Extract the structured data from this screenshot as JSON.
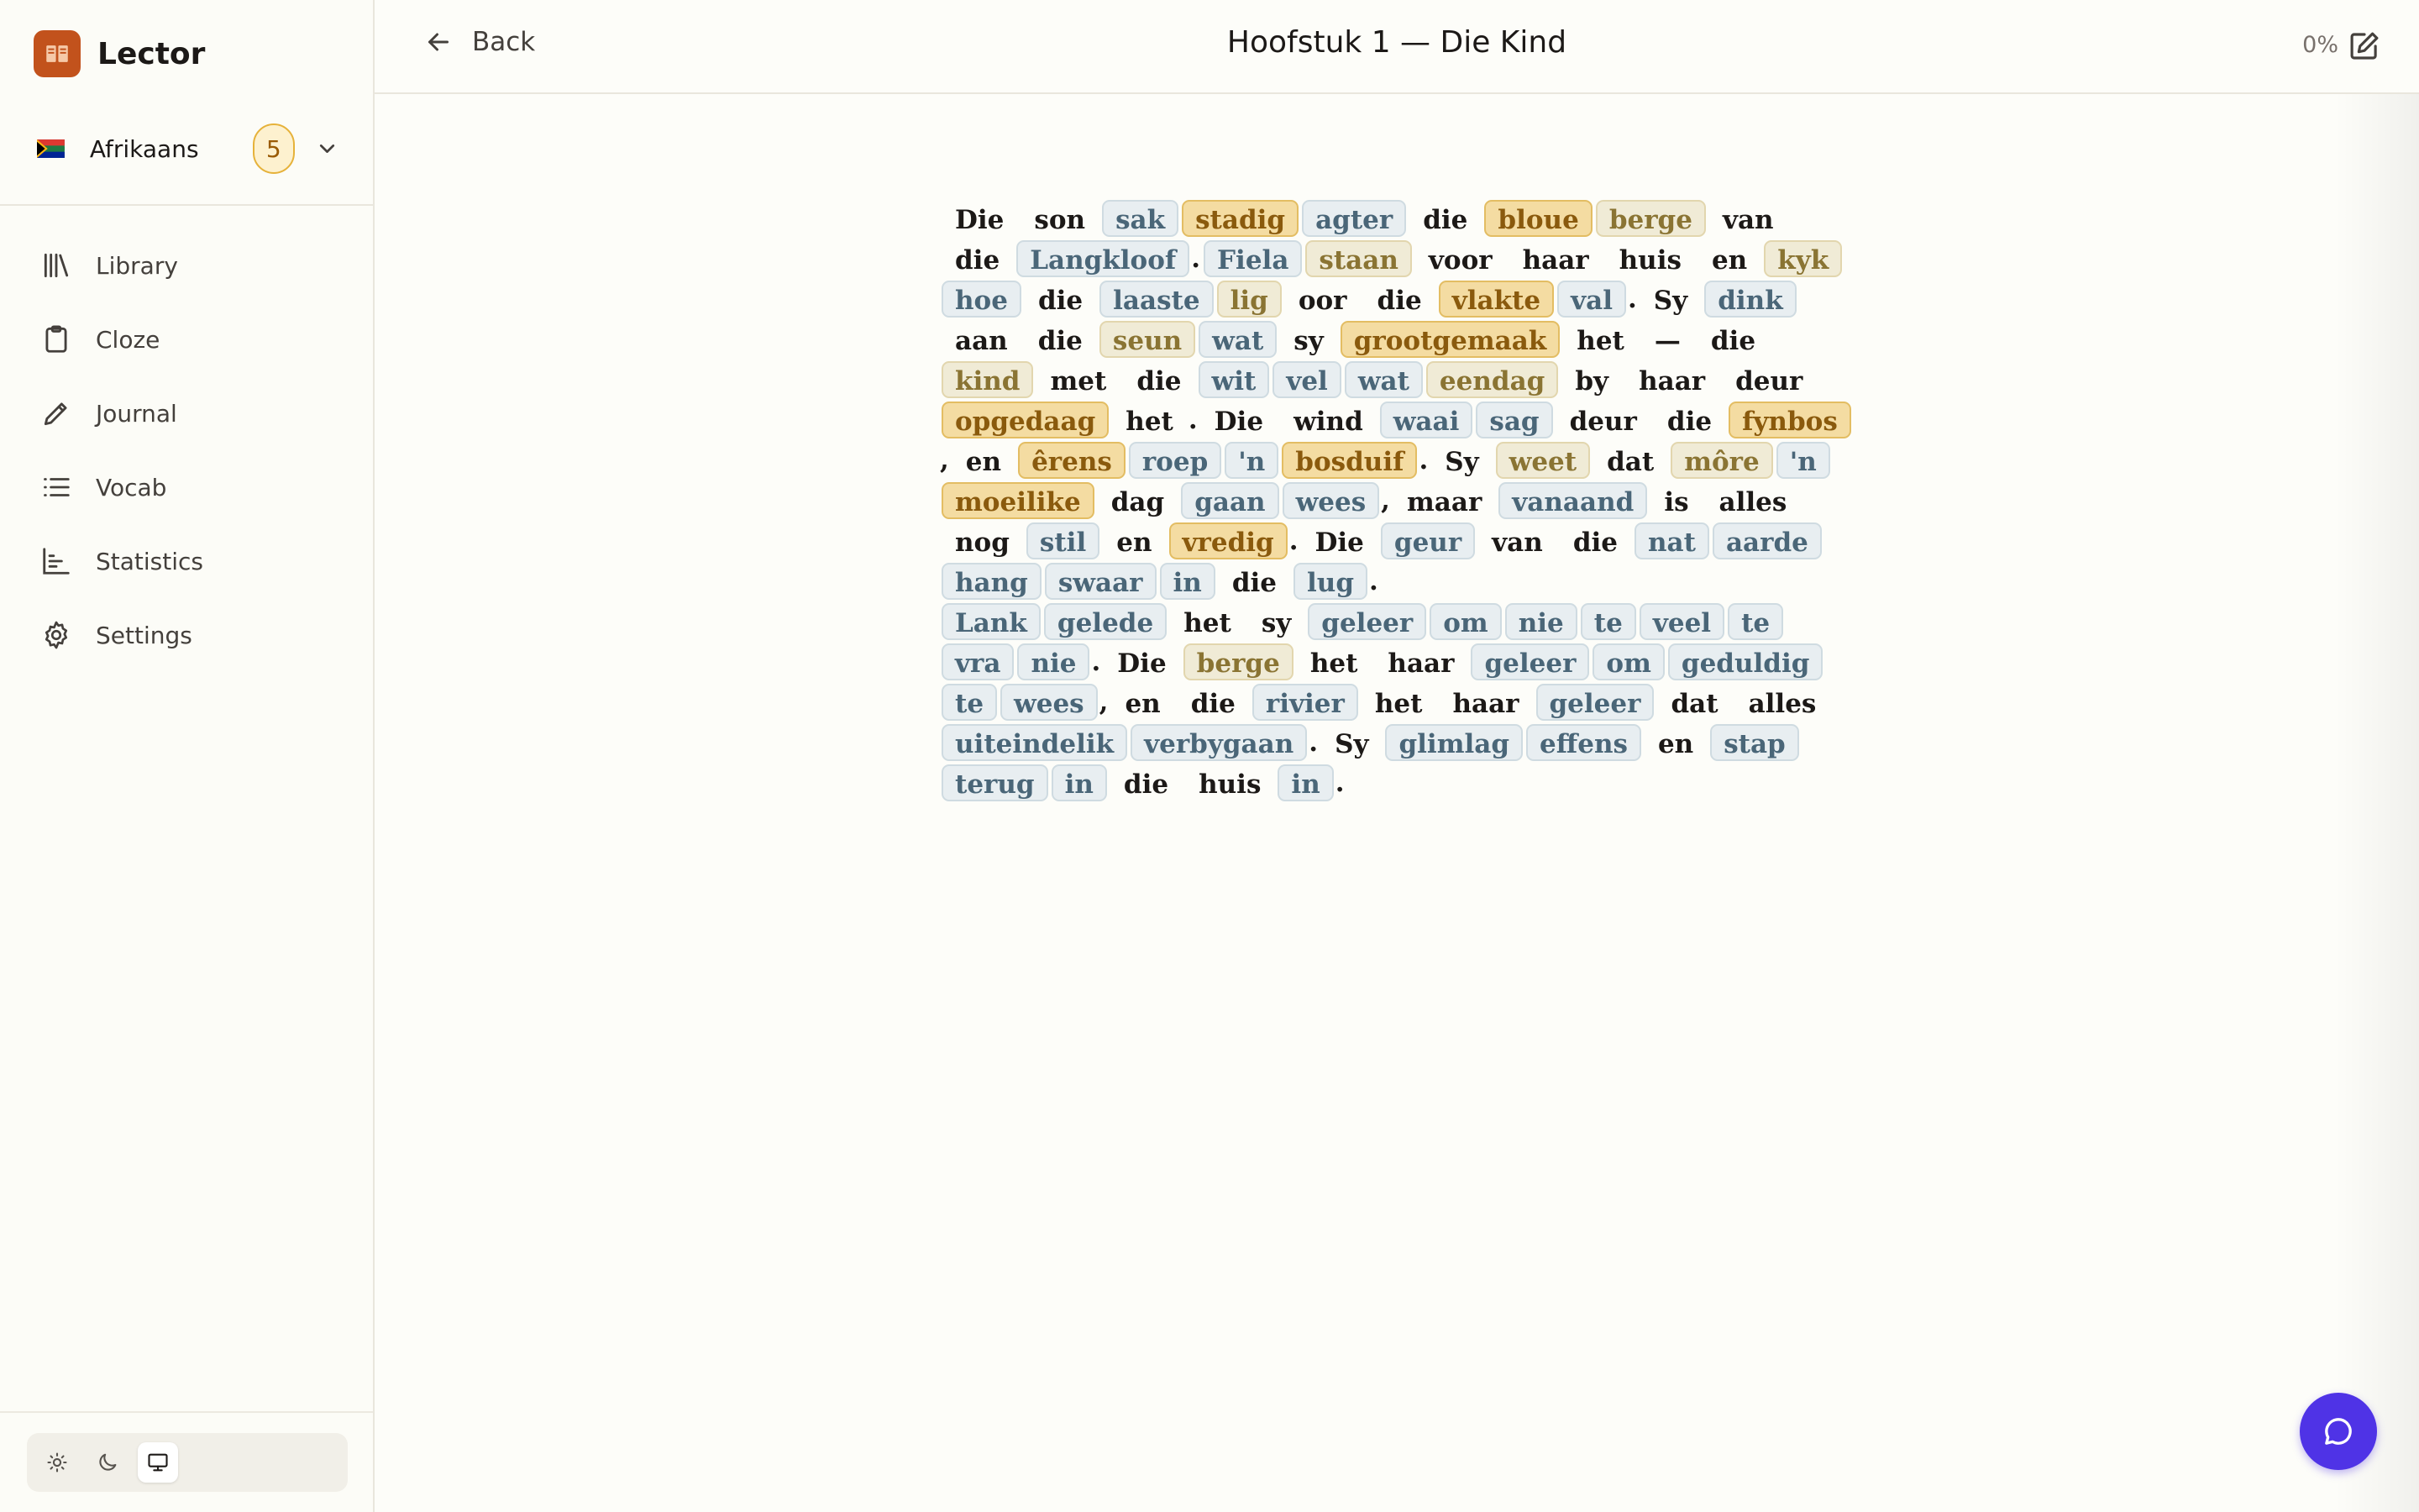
{
  "app": {
    "name": "Lector"
  },
  "language": {
    "name": "Afrikaans",
    "badge": "5"
  },
  "nav": [
    {
      "label": "Library",
      "icon": "library-icon"
    },
    {
      "label": "Cloze",
      "icon": "clipboard-icon"
    },
    {
      "label": "Journal",
      "icon": "pencil-icon"
    },
    {
      "label": "Vocab",
      "icon": "list-icon"
    },
    {
      "label": "Statistics",
      "icon": "bar-chart-icon"
    },
    {
      "label": "Settings",
      "icon": "gear-icon"
    }
  ],
  "theme": {
    "options": [
      "light",
      "dark",
      "system"
    ],
    "selected": "system"
  },
  "header": {
    "back_label": "Back",
    "title": "Hoofstuk 1 — Die Kind",
    "progress": "0%"
  },
  "word_status_colors": {
    "known": "transparent",
    "unknown": "#e8eef1",
    "seen": "#f0ebd6",
    "learning": "#f4dca2"
  },
  "paragraphs": [
    [
      [
        "Die",
        "k"
      ],
      [
        "son",
        "k"
      ],
      [
        "sak",
        "u"
      ],
      [
        "stadig",
        "l"
      ],
      [
        "agter",
        "u"
      ],
      [
        "die",
        "k"
      ],
      [
        "bloue",
        "l"
      ],
      [
        "berge",
        "s"
      ],
      [
        "van",
        "k"
      ],
      [
        "die",
        "k"
      ],
      [
        "Langkloof",
        "u"
      ],
      [
        ".",
        "p"
      ],
      [
        "Fiela",
        "u"
      ],
      [
        "staan",
        "s"
      ],
      [
        "voor",
        "k"
      ],
      [
        "haar",
        "k"
      ],
      [
        "huis",
        "k"
      ],
      [
        "en",
        "k"
      ],
      [
        "kyk",
        "s"
      ],
      [
        "hoe",
        "u"
      ],
      [
        "die",
        "k"
      ],
      [
        "laaste",
        "u"
      ],
      [
        "lig",
        "s"
      ],
      [
        "oor",
        "k"
      ],
      [
        "die",
        "k"
      ],
      [
        "vlakte",
        "l"
      ],
      [
        "val",
        "u"
      ],
      [
        ".",
        "p"
      ],
      [
        "Sy",
        "k"
      ],
      [
        "dink",
        "u"
      ],
      [
        "aan",
        "k"
      ],
      [
        "die",
        "k"
      ],
      [
        "seun",
        "s"
      ],
      [
        "wat",
        "u"
      ],
      [
        "sy",
        "k"
      ],
      [
        "grootgemaak",
        "l"
      ],
      [
        "het",
        "k"
      ],
      [
        "—",
        "k"
      ],
      [
        "die",
        "k"
      ],
      [
        "kind",
        "s"
      ],
      [
        "met",
        "k"
      ],
      [
        "die",
        "k"
      ],
      [
        "wit",
        "u"
      ],
      [
        "vel",
        "u"
      ],
      [
        "wat",
        "u"
      ],
      [
        "eendag",
        "s"
      ],
      [
        "by",
        "k"
      ],
      [
        "haar",
        "k"
      ],
      [
        "deur",
        "k"
      ],
      [
        "opgedaag",
        "l"
      ],
      [
        "het",
        "k"
      ],
      [
        ".",
        "p"
      ],
      [
        "Die",
        "k"
      ],
      [
        "wind",
        "k"
      ],
      [
        "waai",
        "u"
      ],
      [
        "sag",
        "u"
      ],
      [
        "deur",
        "k"
      ],
      [
        "die",
        "k"
      ],
      [
        "fynbos",
        "l"
      ],
      [
        ",",
        "p"
      ],
      [
        "en",
        "k"
      ],
      [
        "êrens",
        "l"
      ],
      [
        "roep",
        "u"
      ],
      [
        "'n",
        "u"
      ],
      [
        "bosduif",
        "l"
      ],
      [
        ".",
        "p"
      ],
      [
        "Sy",
        "k"
      ],
      [
        "weet",
        "s"
      ],
      [
        "dat",
        "k"
      ],
      [
        "môre",
        "s"
      ],
      [
        "'n",
        "u"
      ],
      [
        "moeilike",
        "l"
      ],
      [
        "dag",
        "k"
      ],
      [
        "gaan",
        "u"
      ],
      [
        "wees",
        "u"
      ],
      [
        ",",
        "p"
      ],
      [
        "maar",
        "k"
      ],
      [
        "vanaand",
        "u"
      ],
      [
        "is",
        "k"
      ],
      [
        "alles",
        "k"
      ],
      [
        "nog",
        "k"
      ],
      [
        "stil",
        "u"
      ],
      [
        "en",
        "k"
      ],
      [
        "vredig",
        "l"
      ],
      [
        ".",
        "p"
      ],
      [
        "Die",
        "k"
      ],
      [
        "geur",
        "u"
      ],
      [
        "van",
        "k"
      ],
      [
        "die",
        "k"
      ],
      [
        "nat",
        "u"
      ],
      [
        "aarde",
        "u"
      ],
      [
        "hang",
        "u"
      ],
      [
        "swaar",
        "u"
      ],
      [
        "in",
        "u"
      ],
      [
        "die",
        "k"
      ],
      [
        "lug",
        "u"
      ],
      [
        ".",
        "p"
      ]
    ],
    [
      [
        "Lank",
        "u"
      ],
      [
        "gelede",
        "u"
      ],
      [
        "het",
        "k"
      ],
      [
        "sy",
        "k"
      ],
      [
        "geleer",
        "u"
      ],
      [
        "om",
        "u"
      ],
      [
        "nie",
        "u"
      ],
      [
        "te",
        "u"
      ],
      [
        "veel",
        "u"
      ],
      [
        "te",
        "u"
      ],
      [
        "vra",
        "u"
      ],
      [
        "nie",
        "u"
      ],
      [
        ".",
        "p"
      ],
      [
        "Die",
        "k"
      ],
      [
        "berge",
        "s"
      ],
      [
        "het",
        "k"
      ],
      [
        "haar",
        "k"
      ],
      [
        "geleer",
        "u"
      ],
      [
        "om",
        "u"
      ],
      [
        "geduldig",
        "u"
      ],
      [
        "te",
        "u"
      ],
      [
        "wees",
        "u"
      ],
      [
        ",",
        "p"
      ],
      [
        "en",
        "k"
      ],
      [
        "die",
        "k"
      ],
      [
        "rivier",
        "u"
      ],
      [
        "het",
        "k"
      ],
      [
        "haar",
        "k"
      ],
      [
        "geleer",
        "u"
      ],
      [
        "dat",
        "k"
      ],
      [
        "alles",
        "k"
      ],
      [
        "uiteindelik",
        "u"
      ],
      [
        "verbygaan",
        "u"
      ],
      [
        ".",
        "p"
      ],
      [
        "Sy",
        "k"
      ],
      [
        "glimlag",
        "u"
      ],
      [
        "effens",
        "u"
      ],
      [
        "en",
        "k"
      ],
      [
        "stap",
        "u"
      ],
      [
        "terug",
        "u"
      ],
      [
        "in",
        "u"
      ],
      [
        "die",
        "k"
      ],
      [
        "huis",
        "k"
      ],
      [
        "in",
        "u"
      ],
      [
        ".",
        "p"
      ]
    ]
  ]
}
